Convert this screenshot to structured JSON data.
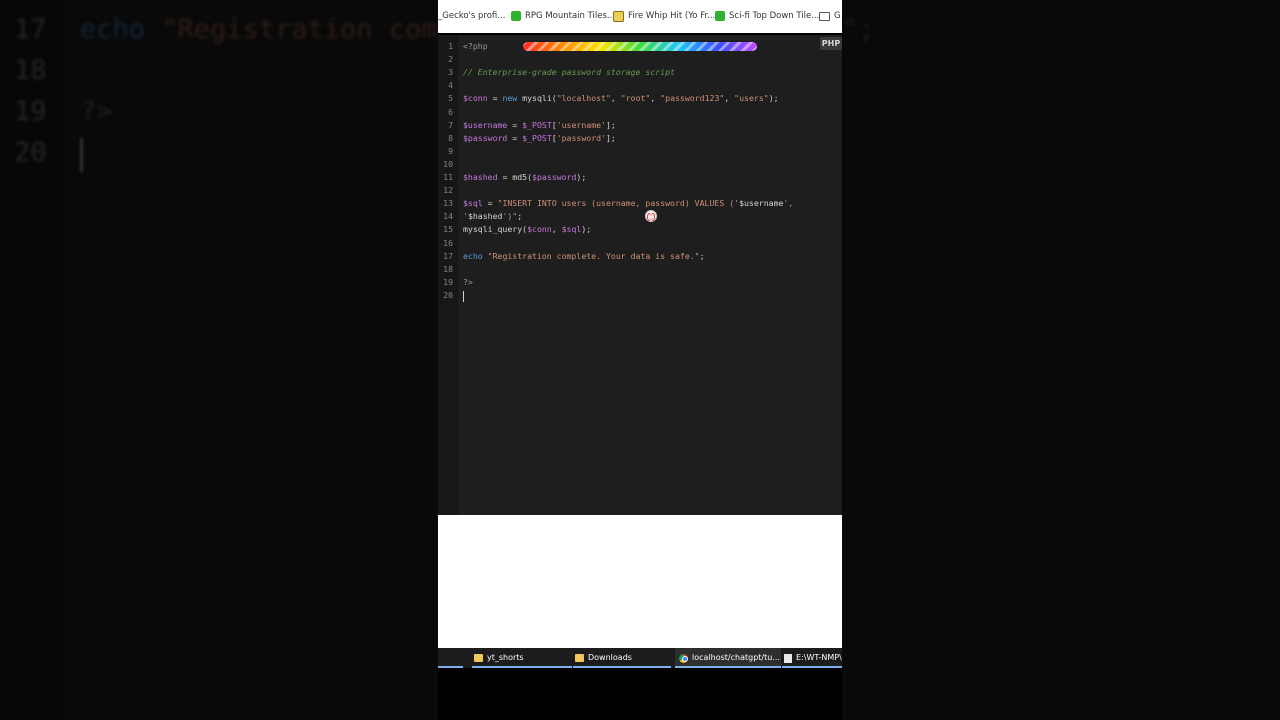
{
  "background_zoom": {
    "lines": [
      {
        "num": "17",
        "code": "echo \"Registration com"
      },
      {
        "num": "18",
        "code": ""
      },
      {
        "num": "19",
        "code": "?>"
      },
      {
        "num": "20",
        "code": ""
      }
    ],
    "right_fragment": "\";"
  },
  "bookmarks": [
    {
      "label": "_Gecko's profi...",
      "icon": "none"
    },
    {
      "label": "RPG Mountain Tiles...",
      "icon": "green-leaf-icon"
    },
    {
      "label": "Fire Whip Hit (Yo Fr...",
      "icon": "fire-icon"
    },
    {
      "label": "Sci-fi Top Down Tile...",
      "icon": "green-leaf-icon"
    },
    {
      "label": "G",
      "icon": "folder-icon"
    }
  ],
  "editor": {
    "language_badge": "PHP",
    "lines": [
      {
        "num": "1",
        "tokens": [
          {
            "t": "<?php",
            "c": "php"
          }
        ]
      },
      {
        "num": "2",
        "tokens": []
      },
      {
        "num": "3",
        "tokens": [
          {
            "t": "// Enterprise-grade password storage script",
            "c": "comment"
          }
        ]
      },
      {
        "num": "4",
        "tokens": []
      },
      {
        "num": "5",
        "tokens": [
          {
            "t": "$conn",
            "c": "var"
          },
          {
            "t": " = ",
            "c": "plain"
          },
          {
            "t": "new",
            "c": "kw"
          },
          {
            "t": " mysqli(",
            "c": "plain"
          },
          {
            "t": "\"localhost\"",
            "c": "str"
          },
          {
            "t": ", ",
            "c": "plain"
          },
          {
            "t": "\"root\"",
            "c": "str"
          },
          {
            "t": ", ",
            "c": "plain"
          },
          {
            "t": "\"password123\"",
            "c": "str"
          },
          {
            "t": ", ",
            "c": "plain"
          },
          {
            "t": "\"users\"",
            "c": "str"
          },
          {
            "t": ");",
            "c": "plain"
          }
        ]
      },
      {
        "num": "6",
        "tokens": []
      },
      {
        "num": "7",
        "tokens": [
          {
            "t": "$username",
            "c": "var"
          },
          {
            "t": " = ",
            "c": "plain"
          },
          {
            "t": "$_POST",
            "c": "var"
          },
          {
            "t": "[",
            "c": "plain"
          },
          {
            "t": "'username'",
            "c": "str"
          },
          {
            "t": "];",
            "c": "plain"
          }
        ]
      },
      {
        "num": "8",
        "tokens": [
          {
            "t": "$password",
            "c": "var"
          },
          {
            "t": " = ",
            "c": "plain"
          },
          {
            "t": "$_POST",
            "c": "var"
          },
          {
            "t": "[",
            "c": "plain"
          },
          {
            "t": "'password'",
            "c": "str"
          },
          {
            "t": "];",
            "c": "plain"
          }
        ]
      },
      {
        "num": "9",
        "tokens": []
      },
      {
        "num": "10",
        "tokens": []
      },
      {
        "num": "11",
        "tokens": [
          {
            "t": "$hashed",
            "c": "var"
          },
          {
            "t": " = md5(",
            "c": "plain"
          },
          {
            "t": "$password",
            "c": "var"
          },
          {
            "t": ");",
            "c": "plain"
          }
        ]
      },
      {
        "num": "12",
        "tokens": []
      },
      {
        "num": "13",
        "tokens": [
          {
            "t": "$sql",
            "c": "var"
          },
          {
            "t": " = ",
            "c": "plain"
          },
          {
            "t": "\"INSERT INTO users (username, password) VALUES ('",
            "c": "str"
          },
          {
            "t": "$username",
            "c": "plain"
          },
          {
            "t": "',",
            "c": "str"
          }
        ]
      },
      {
        "num": "14",
        "tokens": [
          {
            "t": "'",
            "c": "str"
          },
          {
            "t": "$hashed",
            "c": "plain"
          },
          {
            "t": "')\"",
            "c": "str"
          },
          {
            "t": ";",
            "c": "plain"
          }
        ]
      },
      {
        "num": "15",
        "tokens": [
          {
            "t": "mysqli_query(",
            "c": "plain"
          },
          {
            "t": "$conn",
            "c": "var"
          },
          {
            "t": ", ",
            "c": "plain"
          },
          {
            "t": "$sql",
            "c": "var"
          },
          {
            "t": ");",
            "c": "plain"
          }
        ]
      },
      {
        "num": "16",
        "tokens": []
      },
      {
        "num": "17",
        "tokens": [
          {
            "t": "echo",
            "c": "kw"
          },
          {
            "t": " ",
            "c": "plain"
          },
          {
            "t": "\"Registration complete. Your data is safe.\"",
            "c": "str"
          },
          {
            "t": ";",
            "c": "plain"
          }
        ]
      },
      {
        "num": "18",
        "tokens": []
      },
      {
        "num": "19",
        "tokens": [
          {
            "t": "?>",
            "c": "php"
          }
        ]
      },
      {
        "num": "20",
        "tokens": []
      }
    ]
  },
  "taskbar": [
    {
      "label": "yt_shorts",
      "icon": "folder-icon"
    },
    {
      "label": "Downloads",
      "icon": "folder-icon"
    },
    {
      "label": "localhost/chatgpt/tu...",
      "icon": "chrome-icon"
    },
    {
      "label": "E:\\WT-NMP\\",
      "icon": "document-icon"
    }
  ],
  "colors": {
    "editor_bg": "#1e1e1e",
    "comment": "#6a9955",
    "variable": "#c678dd",
    "string": "#ce9178",
    "keyword": "#569cd6"
  }
}
